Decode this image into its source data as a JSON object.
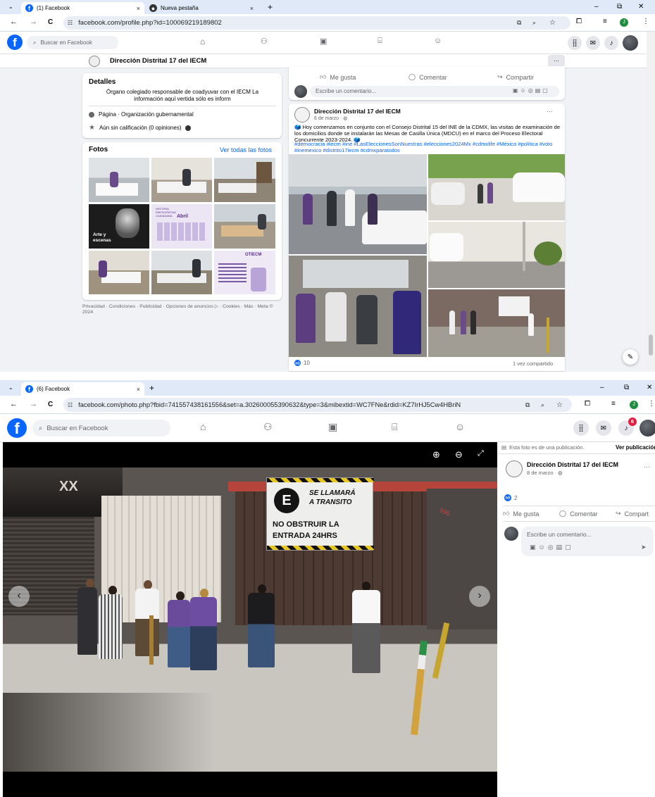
{
  "top": {
    "tabs": [
      {
        "title": "(1) Facebook",
        "close": "×"
      },
      {
        "title": "Nueva pestaña",
        "close": "×"
      }
    ],
    "new_tab": "+",
    "window_controls": {
      "minimize": "–",
      "restore": "⧉",
      "close": "✕"
    },
    "nav": {
      "back": "←",
      "forward": "→",
      "reload": "C"
    },
    "url": "facebook.com/profile.php?id=100069219189802",
    "profile_initial": "J",
    "search_placeholder": "Buscar en Facebook",
    "page_name": "Dirección Distrital 17 del IECM",
    "more": "···",
    "details": {
      "heading": "Detalles",
      "bio": "Órgano colegiado responsable de coadyuvar con el IECM La información aquí vertida sólo es inform",
      "category": "Página · Organización gubernamental",
      "rating": "Aún sin calificación (0 opiniones)"
    },
    "photos": {
      "heading": "Fotos",
      "see_all": "Ver todas las fotos",
      "thumb_texts": {
        "arte": "Arte y escenas",
        "abril": "Abril",
        "abril_sub": "HISTORIA PARTICIPATIVA CIUDADANA",
        "ofi": "OTIECM"
      }
    },
    "footer": "Privacidad · Condiciones · Publicidad · Opciones de anuncios ▷ · Cookies · Más · Meta © 2024",
    "prev_post": {
      "like": "Me gusta",
      "comment": "Comentar",
      "share": "Compartir",
      "write_comment": "Escribe un comentario..."
    },
    "post": {
      "author": "Dirección Distrital 17 del IECM",
      "date": "6 de marzo · ",
      "text": "🗳️ Hoy comenzamos en conjunto con el Consejo Distrital 15 del INE de la CDMX, las visitas de examinación de los domicilios donde se instalarán las Mesas de Casilla Única (MDCU) en el marco del Proceso Electoral Concurrente 2023-2024. 🗳️",
      "hashtags": "#democracia #iecm #ine #LasEleccionesSonNuestras #elecciones2024Mx #cdmxlife #México #política #voto #inemexico #distrito17iecm #cdmxparatodos",
      "reactions": "10",
      "shares": "1 vez compartido"
    },
    "sign_text": "NO OBSTRUIR LA ENTRADA 24HRS"
  },
  "bottom": {
    "tabs": [
      {
        "title": "(6) Facebook",
        "close": "×"
      }
    ],
    "new_tab": "+",
    "window_controls": {
      "minimize": "–",
      "restore": "⧉",
      "close": "✕"
    },
    "nav": {
      "back": "←",
      "forward": "→",
      "reload": "C"
    },
    "url": "facebook.com/photo.php?fbid=741557438161556&set=a.302600055390632&type=3&mibextid=WC7FNe&rdid=KZ7IrHJ5Cw4HBriN",
    "profile_initial": "J",
    "search_placeholder": "Buscar en Facebook",
    "notification_count": "6",
    "photo_sign": {
      "line1": "SE LLAMARÁ",
      "line2": "A TRANSITO",
      "line3": "NO OBSTRUIR LA",
      "line4": "ENTRADA 24HRS",
      "letter": "E",
      "store": "XX",
      "number": "595"
    },
    "side": {
      "from_publication": "Esta foto es de una publicación.",
      "see_publication": "Ver publicación",
      "author": "Dirección Distrital 17 del IECM",
      "date": "8 de marzo · ",
      "reactions": "2",
      "like": "Me gusta",
      "comment": "Comentar",
      "share": "Compart",
      "write_comment": "Escribe un comentario...",
      "more": "···"
    }
  },
  "colors": {
    "fb_blue": "#0866ff",
    "tab_strip": "#dfe9f7",
    "feed_bg": "#f0f2f5",
    "viewer_bg": "#000000"
  }
}
